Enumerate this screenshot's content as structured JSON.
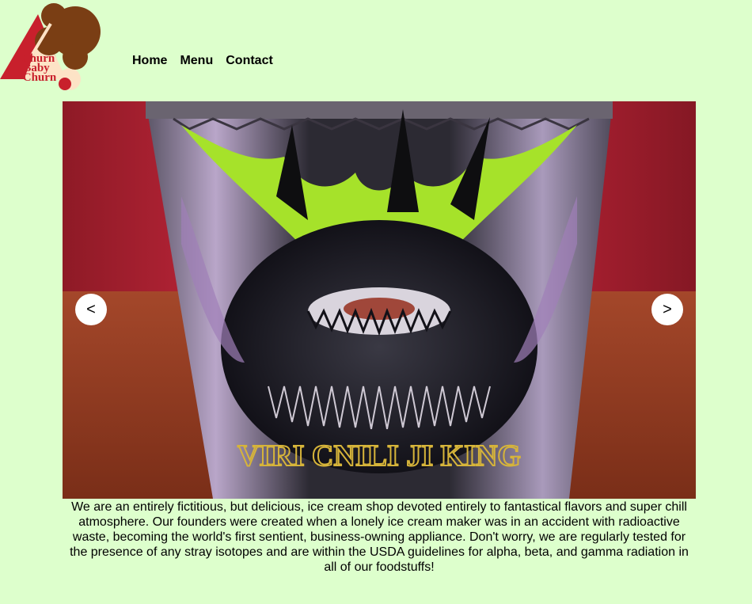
{
  "logo": {
    "lines": [
      "Churn",
      "Baby",
      "Churn"
    ]
  },
  "nav": {
    "items": [
      {
        "label": "Home"
      },
      {
        "label": "Menu"
      },
      {
        "label": "Contact"
      }
    ]
  },
  "carousel": {
    "prev_label": "<",
    "next_label": ">",
    "image_caption_glyphs": "VIRI CNILI JI KING"
  },
  "about": {
    "text": "We are an entirely fictitious, but delicious, ice cream shop devoted entirely to fantastical flavors and super chill atmosphere. Our founders were created when a lonely ice cream maker was in an accident with radioactive waste, becoming the world's first sentient, business-owning appliance. Don't worry, we are regularly tested for the presence of any stray isotopes and are within the USDA guidelines for alpha, beta, and gamma radiation in all of our foodstuffs!"
  },
  "colors": {
    "background": "#ddffcc",
    "logo_brown": "#7a3e14",
    "logo_red": "#c8202c",
    "logo_cream": "#fde3c6"
  }
}
